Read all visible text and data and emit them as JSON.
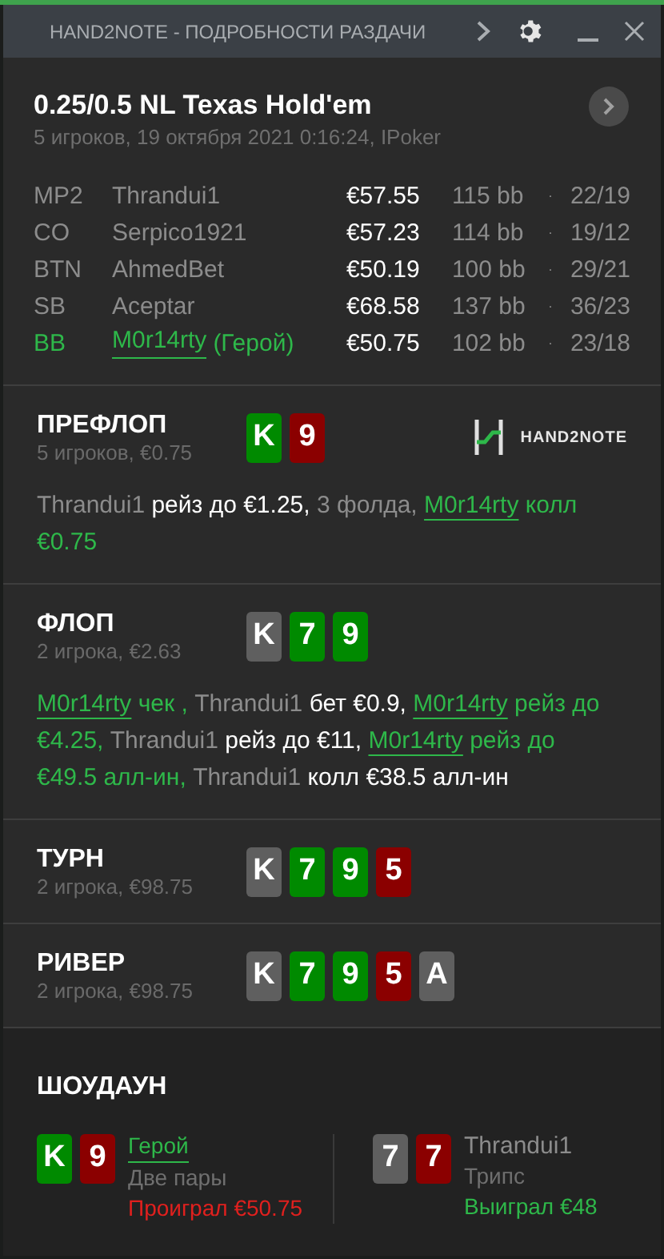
{
  "window": {
    "title": "HAND2NOTE - ПОДРОБНОСТИ РАЗДАЧИ"
  },
  "header": {
    "title": "0.25/0.5 NL Texas Hold'em",
    "subtitle": "5 игроков, 19 октября 2021 0:16:24, IPoker"
  },
  "players": [
    {
      "position": "MP2",
      "name": "Thrandui1",
      "hero": false,
      "stack": "€57.55",
      "bb": "115 bb",
      "separator": "·",
      "ratio": "22/19"
    },
    {
      "position": "CO",
      "name": "Serpico1921",
      "hero": false,
      "stack": "€57.23",
      "bb": "114 bb",
      "separator": "·",
      "ratio": "19/12"
    },
    {
      "position": "BTN",
      "name": "AhmedBet",
      "hero": false,
      "stack": "€50.19",
      "bb": "100 bb",
      "separator": "·",
      "ratio": "29/21"
    },
    {
      "position": "SB",
      "name": "Aceptar",
      "hero": false,
      "stack": "€68.58",
      "bb": "137 bb",
      "separator": "·",
      "ratio": "36/23"
    },
    {
      "position": "BB",
      "name": "M0r14rty",
      "hero": true,
      "hero_label": "(Герой)",
      "stack": "€50.75",
      "bb": "102 bb",
      "separator": "·",
      "ratio": "23/18"
    }
  ],
  "streets": [
    {
      "title": "ПРЕФЛОП",
      "info": "5 игроков, €0.75",
      "logo": "HAND2NOTE",
      "cards": [
        {
          "rank": "K",
          "color": "#008a00"
        },
        {
          "rank": "9",
          "color": "#8b0000"
        }
      ],
      "actions": [
        {
          "kind": "name",
          "text": "Thrandui1"
        },
        {
          "kind": "action",
          "text": "рейз до €1.25,"
        },
        {
          "kind": "muted",
          "text": "3 фолда,"
        },
        {
          "kind": "hero_name",
          "text": "M0r14rty"
        },
        {
          "kind": "hero_action",
          "text": "колл €0.75"
        }
      ]
    },
    {
      "title": "ФЛОП",
      "info": "2 игрока, €2.63",
      "cards": [
        {
          "rank": "K",
          "color": "#5f5f5f"
        },
        {
          "rank": "7",
          "color": "#008a00"
        },
        {
          "rank": "9",
          "color": "#008a00"
        }
      ],
      "actions": [
        {
          "kind": "hero_name",
          "text": "M0r14rty"
        },
        {
          "kind": "hero_action",
          "text": "чек ,"
        },
        {
          "kind": "name",
          "text": "Thrandui1"
        },
        {
          "kind": "action",
          "text": "бет €0.9,"
        },
        {
          "kind": "hero_name",
          "text": "M0r14rty"
        },
        {
          "kind": "hero_action",
          "text": "рейз до €4.25,"
        },
        {
          "kind": "name",
          "text": "Thrandui1"
        },
        {
          "kind": "action",
          "text": "рейз до €11,"
        },
        {
          "kind": "hero_name",
          "text": "M0r14rty"
        },
        {
          "kind": "hero_action",
          "text": "рейз до €49.5 алл-ин,"
        },
        {
          "kind": "name",
          "text": "Thrandui1"
        },
        {
          "kind": "action",
          "text": "колл €38.5 алл-ин"
        }
      ]
    },
    {
      "title": "ТУРН",
      "info": "2 игрока, €98.75",
      "cards": [
        {
          "rank": "K",
          "color": "#5f5f5f"
        },
        {
          "rank": "7",
          "color": "#008a00"
        },
        {
          "rank": "9",
          "color": "#008a00"
        },
        {
          "rank": "5",
          "color": "#8b0000"
        }
      ]
    },
    {
      "title": "РИВЕР",
      "info": "2 игрока, €98.75",
      "cards": [
        {
          "rank": "K",
          "color": "#5f5f5f"
        },
        {
          "rank": "7",
          "color": "#008a00"
        },
        {
          "rank": "9",
          "color": "#008a00"
        },
        {
          "rank": "5",
          "color": "#8b0000"
        },
        {
          "rank": "A",
          "color": "#5f5f5f"
        }
      ]
    }
  ],
  "showdown": {
    "title": "ШОУДАУН",
    "hands": [
      {
        "player": "Герой",
        "hero": true,
        "hand": "Две пары",
        "result": "Проиграл €50.75",
        "won": false,
        "cards": [
          {
            "rank": "K",
            "color": "#008a00"
          },
          {
            "rank": "9",
            "color": "#8b0000"
          }
        ]
      },
      {
        "player": "Thrandui1",
        "hero": false,
        "hand": "Трипс",
        "result": "Выиграл €48",
        "won": true,
        "cards": [
          {
            "rank": "7",
            "color": "#5f5f5f"
          },
          {
            "rank": "7",
            "color": "#8b0000"
          }
        ]
      }
    ]
  }
}
